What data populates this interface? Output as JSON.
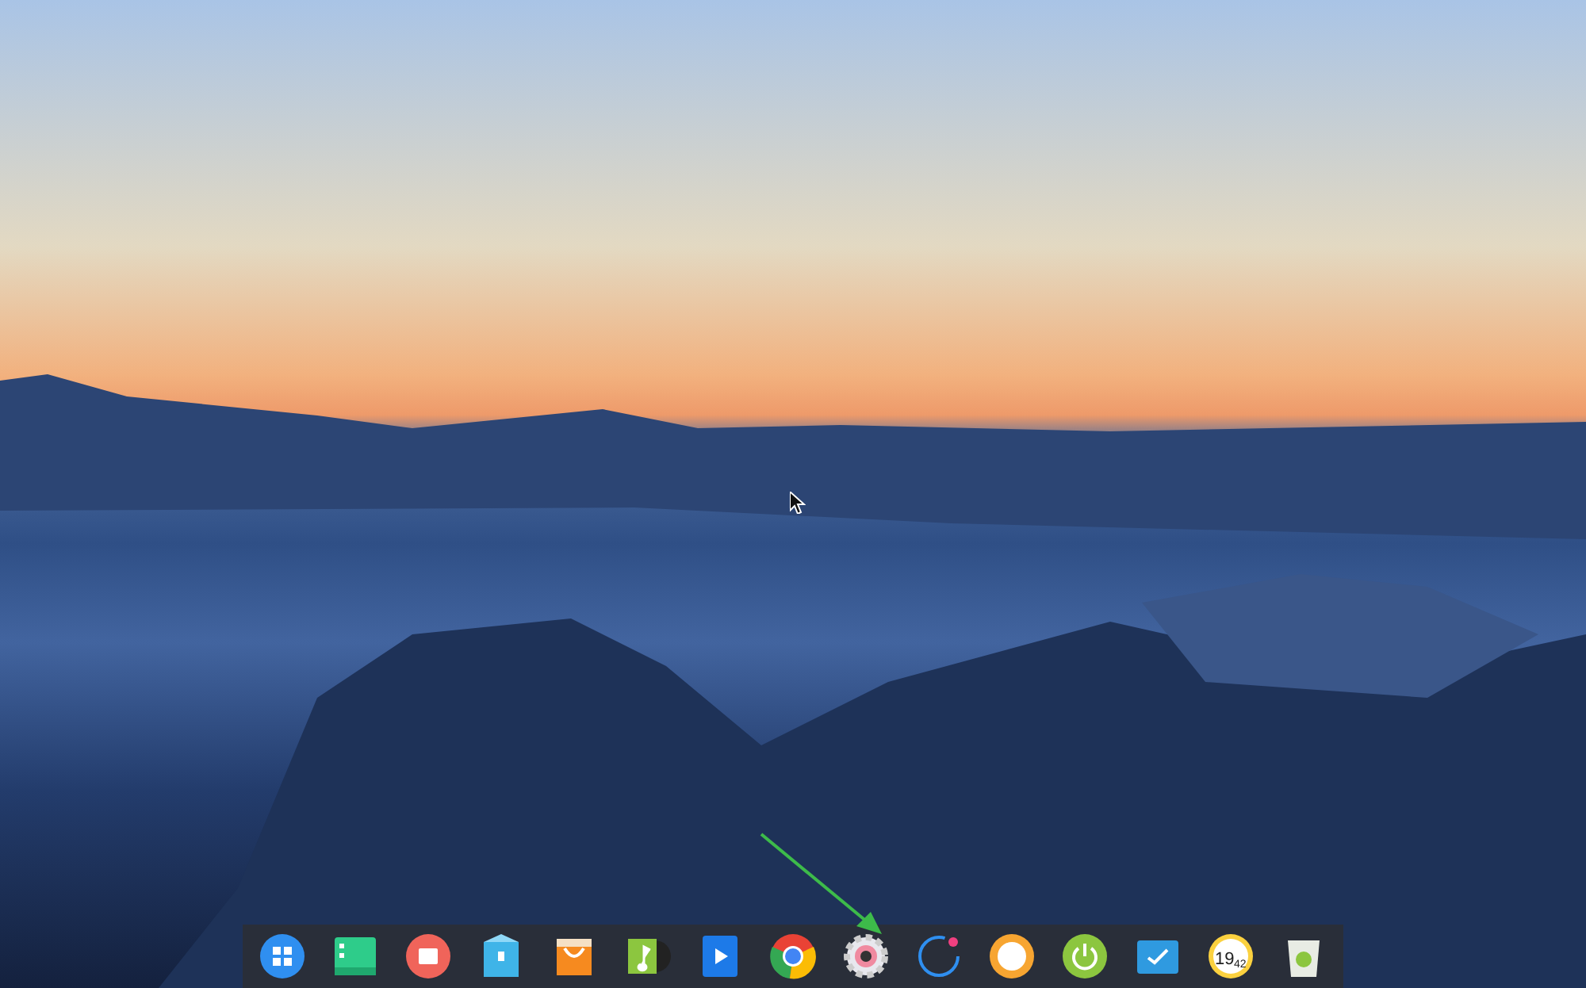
{
  "dock": {
    "items": [
      {
        "kind": "launcher"
      },
      {
        "kind": "file-manager"
      },
      {
        "kind": "app-store-red"
      },
      {
        "kind": "archive"
      },
      {
        "kind": "store"
      },
      {
        "kind": "music"
      },
      {
        "kind": "video"
      },
      {
        "kind": "browser"
      },
      {
        "kind": "settings"
      },
      {
        "kind": "monitor"
      },
      {
        "kind": "theme"
      },
      {
        "kind": "power"
      },
      {
        "kind": "screenshot"
      },
      {
        "kind": "clock",
        "hour": "19",
        "minute": "42"
      },
      {
        "kind": "trash"
      }
    ]
  }
}
